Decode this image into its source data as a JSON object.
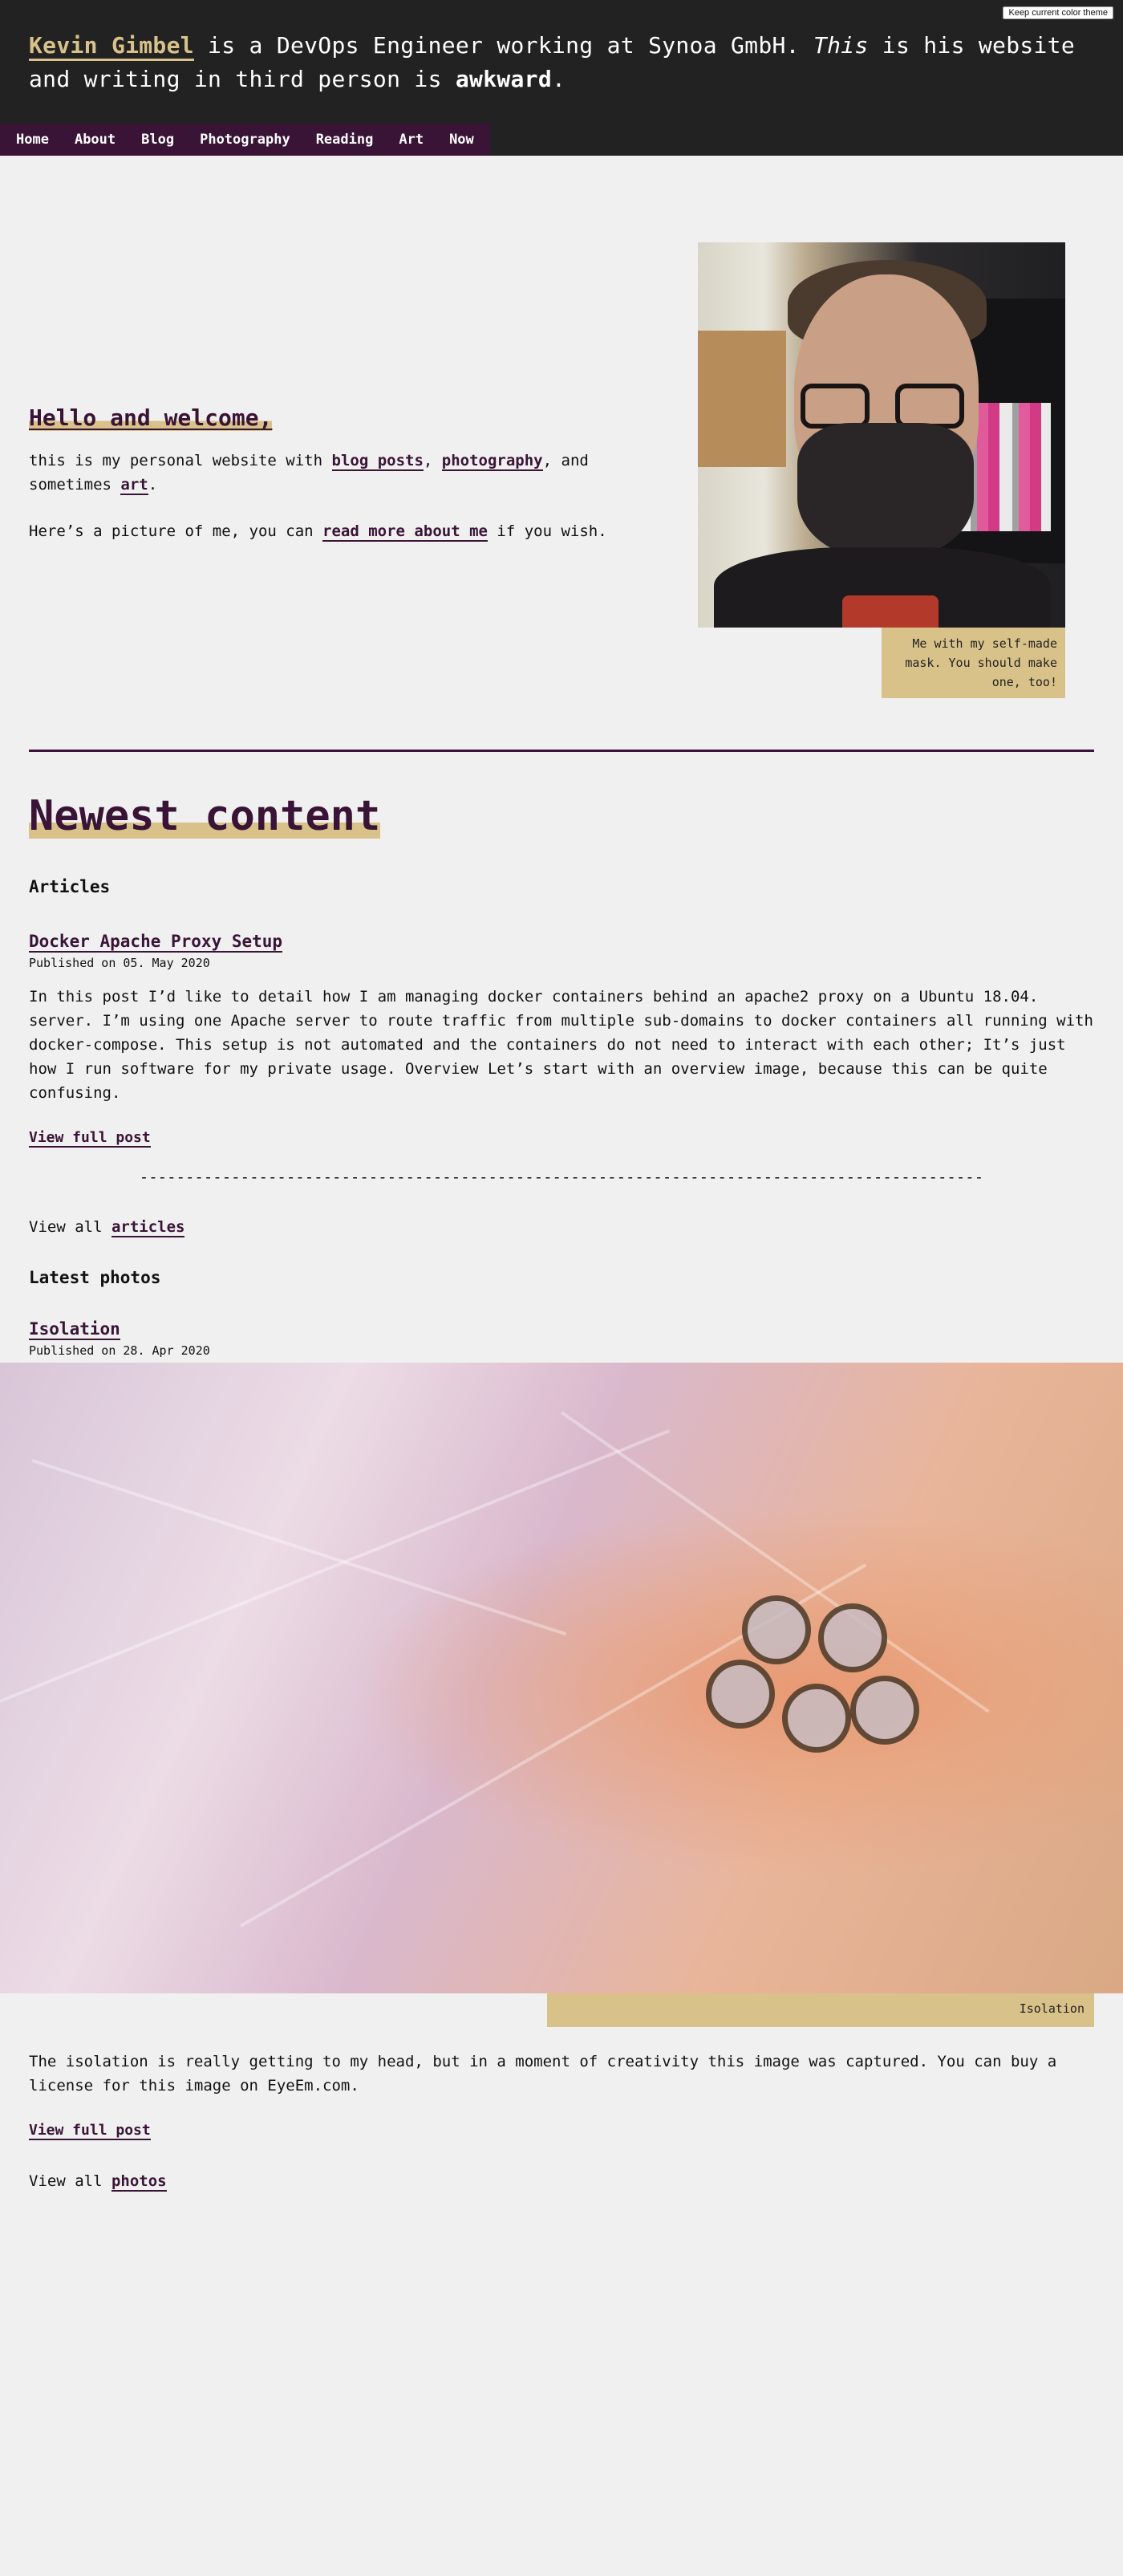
{
  "header": {
    "theme_button": "Keep current color theme",
    "intro": {
      "name": "Kevin Gimbel",
      "part1": " is a DevOps Engineer working at Synoa GmbH. ",
      "this": "This",
      "part2": " is his website and writing in third person is ",
      "awkward": "awkward",
      "end": "."
    },
    "nav": [
      "Home",
      "About",
      "Blog",
      "Photography",
      "Reading",
      "Art",
      "Now"
    ]
  },
  "welcome": {
    "heading": "Hello and welcome,",
    "line1_a": "this is my personal website with ",
    "link_blog": "blog posts",
    "sep1": ", ",
    "link_photography": "photography",
    "line1_b": ", and sometimes ",
    "link_art": "art",
    "line1_end": ".",
    "line2_a": "Here’s a picture of me, you can ",
    "link_about": "read more about me",
    "line2_b": " if you wish.",
    "image_caption": "Me with my self-made mask. You should make one, too!"
  },
  "newest": {
    "heading": "Newest content",
    "articles_heading": "Articles",
    "article": {
      "title": "Docker Apache Proxy Setup",
      "published": "Published on 05. May 2020",
      "excerpt": "In this post I’d like to detail how I am managing docker containers behind an apache2 proxy on a Ubuntu 18.04. server. I’m using one Apache server to route traffic from multiple sub-domains to docker containers all running with docker-compose. This setup is not automated and the containers do not need to interact with each other; It’s just how I run software for my private usage. Overview Let’s start with an overview image, because this can be quite confusing.",
      "more": "View full post"
    },
    "separator": "--------------------------------------------------------------------------------------------",
    "view_all_articles_prefix": "View all ",
    "view_all_articles_link": "articles",
    "photos_heading": "Latest photos",
    "photo": {
      "title": "Isolation",
      "published": "Published on 28. Apr 2020",
      "caption": "Isolation",
      "excerpt": "The isolation is really getting to my head, but in a moment of creativity this image was captured. You can buy a license for this image on EyeEm.com.",
      "more": "View full post"
    },
    "view_all_photos_prefix": "View all ",
    "view_all_photos_link": "photos"
  }
}
